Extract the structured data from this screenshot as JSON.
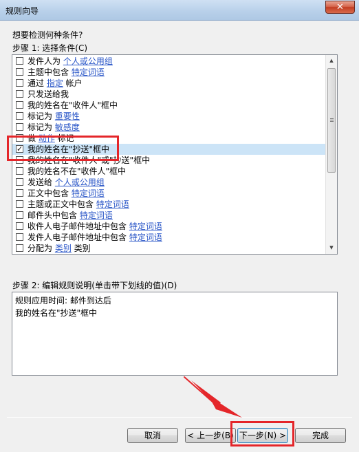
{
  "window": {
    "title": "规则向导",
    "close_glyph": "✕"
  },
  "prompt": {
    "question": "想要检测何种条件?",
    "step1_label": "步骤 1: 选择条件(C)"
  },
  "conditions": [
    {
      "checked": false,
      "selected": false,
      "text": "发件人为 ",
      "link": "个人或公用组",
      "suffix": ""
    },
    {
      "checked": false,
      "selected": false,
      "text": "主题中包含 ",
      "link": "特定词语",
      "suffix": ""
    },
    {
      "checked": false,
      "selected": false,
      "text": "通过 ",
      "link": "指定",
      "suffix": " 帐户"
    },
    {
      "checked": false,
      "selected": false,
      "text": "只发送给我",
      "link": "",
      "suffix": ""
    },
    {
      "checked": false,
      "selected": false,
      "text": "我的姓名在\"收件人\"框中",
      "link": "",
      "suffix": ""
    },
    {
      "checked": false,
      "selected": false,
      "text": "标记为 ",
      "link": "重要性",
      "suffix": ""
    },
    {
      "checked": false,
      "selected": false,
      "text": "标记为 ",
      "link": "敏感度",
      "suffix": ""
    },
    {
      "checked": false,
      "selected": false,
      "text": "做 ",
      "link": "动作",
      "suffix": " 标记"
    },
    {
      "checked": true,
      "selected": true,
      "text": "我的姓名在\"抄送\"框中",
      "link": "",
      "suffix": ""
    },
    {
      "checked": false,
      "selected": false,
      "text": "我的姓名在\"收件人\"或\"抄送\"框中",
      "link": "",
      "suffix": ""
    },
    {
      "checked": false,
      "selected": false,
      "text": "我的姓名不在\"收件人\"框中",
      "link": "",
      "suffix": ""
    },
    {
      "checked": false,
      "selected": false,
      "text": "发送给 ",
      "link": "个人或公用组",
      "suffix": ""
    },
    {
      "checked": false,
      "selected": false,
      "text": "正文中包含 ",
      "link": "特定词语",
      "suffix": ""
    },
    {
      "checked": false,
      "selected": false,
      "text": "主题或正文中包含 ",
      "link": "特定词语",
      "suffix": ""
    },
    {
      "checked": false,
      "selected": false,
      "text": "邮件头中包含 ",
      "link": "特定词语",
      "suffix": ""
    },
    {
      "checked": false,
      "selected": false,
      "text": "收件人电子邮件地址中包含 ",
      "link": "特定词语",
      "suffix": ""
    },
    {
      "checked": false,
      "selected": false,
      "text": "发件人电子邮件地址中包含 ",
      "link": "特定词语",
      "suffix": ""
    },
    {
      "checked": false,
      "selected": false,
      "text": "分配为 ",
      "link": "类别",
      "suffix": " 类别"
    }
  ],
  "scrollbar": {
    "up_glyph": "▲",
    "down_glyph": "▼"
  },
  "description": {
    "step2_label": "步骤 2: 编辑规则说明(单击带下划线的值)(D)",
    "lines": [
      "规则应用时间: 邮件到达后",
      "我的姓名在\"抄送\"框中"
    ]
  },
  "buttons": {
    "cancel": "取消",
    "back": "< 上一步(B)",
    "next": "下一步(N) >",
    "finish": "完成"
  },
  "colors": {
    "annotation": "#e4262a",
    "link": "#2b57c8",
    "selection": "#cce4f7"
  }
}
